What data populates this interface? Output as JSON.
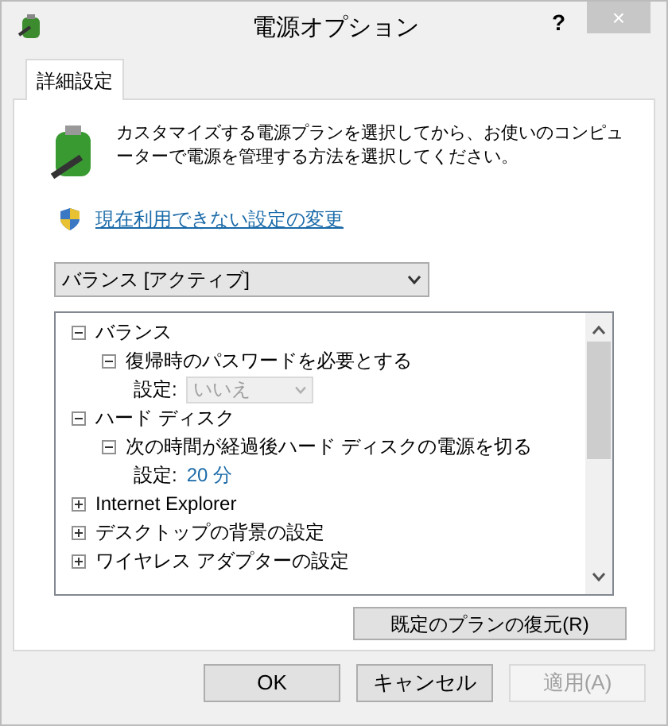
{
  "window": {
    "title": "電源オプション",
    "help": "?",
    "close": "×"
  },
  "tabs": [
    {
      "label": "詳細設定",
      "selected": true
    }
  ],
  "description": "カスタマイズする電源プランを選択してから、お使いのコンピューターで電源を管理する方法を選択してください。",
  "admin_link": "現在利用できない設定の変更",
  "plan_dropdown": {
    "value": "バランス [アクティブ]"
  },
  "tree": [
    {
      "label": "バランス",
      "expanded": true,
      "children": [
        {
          "label": "復帰時のパスワードを必要とする",
          "expanded": true,
          "children": [
            {
              "kind": "dropdown",
              "label": "設定:",
              "value": "いいえ",
              "disabled": true
            }
          ]
        }
      ]
    },
    {
      "label": "ハード ディスク",
      "expanded": true,
      "children": [
        {
          "label": "次の時間が経過後ハード ディスクの電源を切る",
          "expanded": true,
          "children": [
            {
              "kind": "link",
              "label": "設定:",
              "value": "20 分"
            }
          ]
        }
      ]
    },
    {
      "label": "Internet Explorer",
      "expanded": false
    },
    {
      "label": "デスクトップの背景の設定",
      "expanded": false
    },
    {
      "label": "ワイヤレス アダプターの設定",
      "expanded": false
    }
  ],
  "restore_button": "既定のプランの復元(R)",
  "buttons": [
    {
      "label": "OK",
      "disabled": false
    },
    {
      "label": "キャンセル",
      "disabled": false
    },
    {
      "label": "適用(A)",
      "disabled": true
    }
  ]
}
